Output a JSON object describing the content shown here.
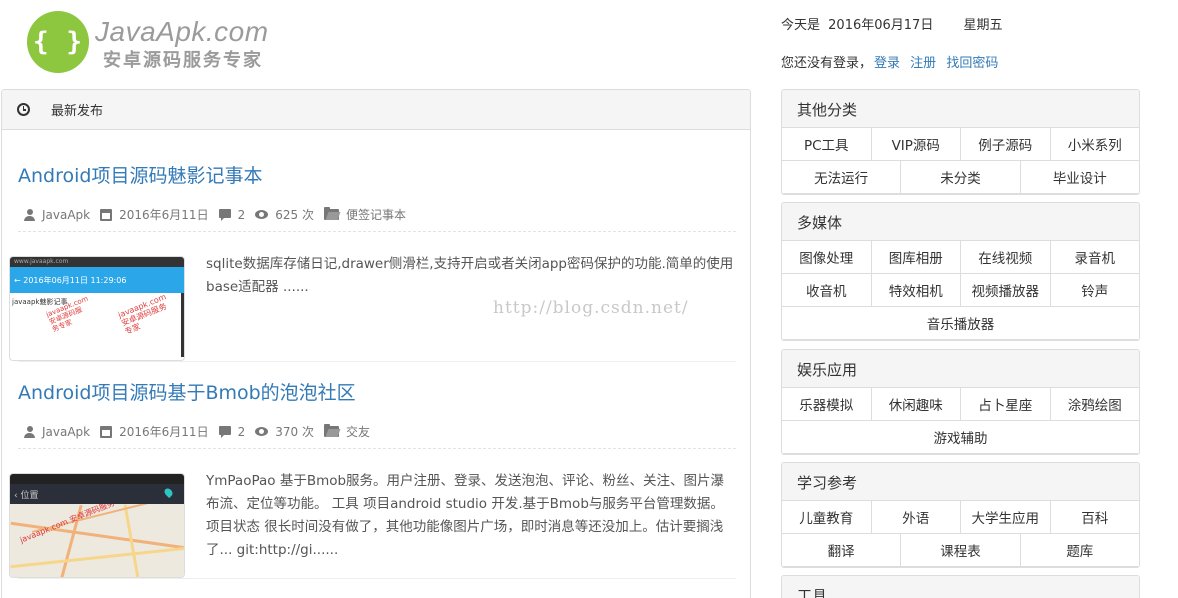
{
  "header": {
    "logo_glyph": "{ }",
    "logo_name": "JavaApk.com",
    "logo_slogan": "安卓源码服务专家",
    "date_prefix": "今天是",
    "date": "2016年06月17日",
    "weekday": "星期五",
    "login_text": "您还没有登录，",
    "login_link": "登录",
    "register_link": "注册",
    "recover_link": "找回密码"
  },
  "main": {
    "heading": "最新发布",
    "posts": [
      {
        "title": "Android项目源码魅影记事本",
        "author": "JavaApk",
        "date": "2016年6月11日",
        "comments": "2",
        "views": "625 次",
        "category": "便签记事本",
        "excerpt": "sqlite数据库存储日记,drawer侧滑栏,支持开启或者关闭app密码保护的功能.简单的使用base适配器 ......"
      },
      {
        "title": "Android项目源码基于Bmob的泡泡社区",
        "author": "JavaApk",
        "date": "2016年6月11日",
        "comments": "2",
        "views": "370 次",
        "category": "交友",
        "excerpt": "YmPaoPao 基于Bmob服务。用户注册、登录、发送泡泡、评论、粉丝、关注、图片瀑布流、定位等功能。 工具 项目android studio 开发.基于Bmob与服务平台管理数据。 项目状态 很长时间没有做了，其他功能像图片广场，即时消息等还没加上。估计要搁浅了... git:http://gi......"
      }
    ],
    "thumb1": {
      "status": "www.javaapk.com",
      "title": "← 2016年06月11日 11:29:06",
      "row": "javaapk魅影记事",
      "wm": "javaapk.com 安卓源码服务专家"
    },
    "thumb2": {
      "nav": "‹ 位置",
      "wm": "javaapk.com 安卓源码服务专家"
    },
    "watermark": "http://blog.csdn.net/"
  },
  "sidebar": [
    {
      "title": "其他分类",
      "rows": [
        [
          "PC工具",
          "VIP源码",
          "例子源码",
          "小米系列"
        ],
        [
          "无法运行",
          "未分类",
          "毕业设计"
        ]
      ]
    },
    {
      "title": "多媒体",
      "rows": [
        [
          "图像处理",
          "图库相册",
          "在线视频",
          "录音机"
        ],
        [
          "收音机",
          "特效相机",
          "视频播放器",
          "铃声"
        ],
        [
          "音乐播放器"
        ]
      ]
    },
    {
      "title": "娱乐应用",
      "rows": [
        [
          "乐器模拟",
          "休闲趣味",
          "占卜星座",
          "涂鸦绘图"
        ],
        [
          "游戏辅助"
        ]
      ]
    },
    {
      "title": "学习参考",
      "rows": [
        [
          "儿童教育",
          "外语",
          "大学生应用",
          "百科"
        ],
        [
          "翻译",
          "课程表",
          "题库"
        ]
      ]
    },
    {
      "title": "工具",
      "rows": []
    }
  ]
}
